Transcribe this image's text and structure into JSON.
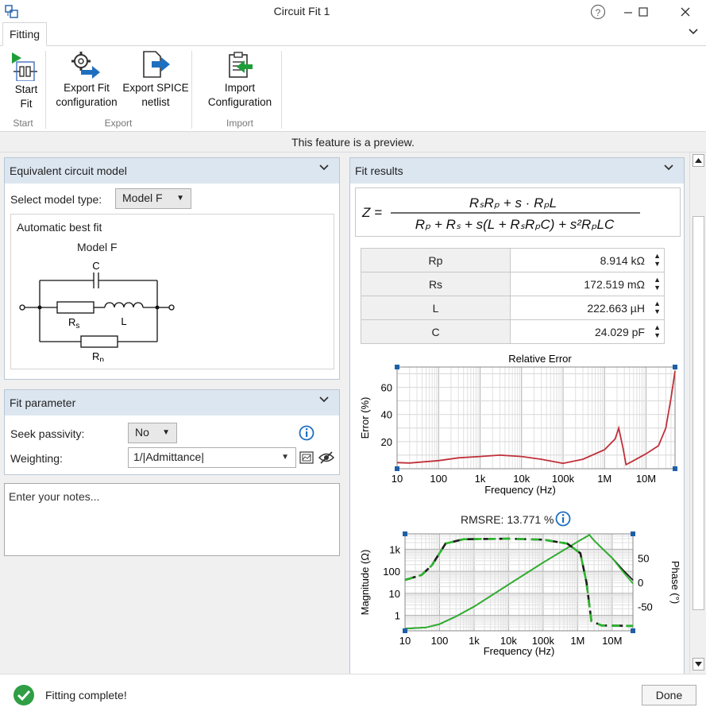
{
  "window": {
    "title": "Circuit Fit 1"
  },
  "tabs": {
    "fitting": "Fitting"
  },
  "ribbon": {
    "start_fit": [
      "Start",
      "Fit"
    ],
    "export_fit": [
      "Export Fit",
      "configuration"
    ],
    "export_spice": [
      "Export SPICE",
      "netlist"
    ],
    "import_cfg": [
      "Import",
      "Configuration"
    ],
    "groups": {
      "start": "Start",
      "export": "Export",
      "import": "Import"
    }
  },
  "preview_text": "This feature is a preview.",
  "equivalent": {
    "header": "Equivalent circuit model",
    "select_label": "Select model type:",
    "model_value": "Model F",
    "best_fit": "Automatic best fit",
    "model_title": "Model F",
    "labels": {
      "c": "C",
      "rs": "R",
      "rs_sub": "s",
      "l": "L",
      "rp": "R",
      "rp_sub": "p"
    }
  },
  "fit_param": {
    "header": "Fit parameter",
    "seek_label": "Seek passivity:",
    "seek_value": "No",
    "weighting_label": "Weighting:",
    "weighting_value": "1/|Admittance|"
  },
  "notes": {
    "placeholder": "Enter your notes..."
  },
  "fit_results": {
    "header": "Fit results",
    "params": [
      {
        "name": "Rp",
        "value": "8.914 kΩ"
      },
      {
        "name": "Rs",
        "value": "172.519 mΩ"
      },
      {
        "name": "L",
        "value": "222.663 µH"
      },
      {
        "name": "C",
        "value": "24.029 pF"
      }
    ],
    "rmsre_label": "RMSRE: 13.771 %"
  },
  "chart_data": [
    {
      "type": "line",
      "title": "Relative Error",
      "xlabel": "Frequency (Hz)",
      "ylabel": "Error (%)",
      "x_scale": "log",
      "xlim": [
        10,
        50000000
      ],
      "ylim": [
        0,
        75
      ],
      "x_ticks": [
        "10",
        "100",
        "1k",
        "10k",
        "100k",
        "1M",
        "10M"
      ],
      "y_ticks": [
        "20",
        "40",
        "60"
      ],
      "series": [
        {
          "color": "#c0303a",
          "points": [
            [
              10,
              4.5
            ],
            [
              20,
              4.2
            ],
            [
              100,
              6
            ],
            [
              300,
              8
            ],
            [
              1000,
              9
            ],
            [
              3000,
              10
            ],
            [
              10000,
              9
            ],
            [
              30000,
              7
            ],
            [
              100000,
              4
            ],
            [
              300000,
              7
            ],
            [
              1000000,
              14
            ],
            [
              1800000,
              22
            ],
            [
              2200000,
              30
            ],
            [
              2800000,
              15
            ],
            [
              3300000,
              3
            ],
            [
              5000000,
              6
            ],
            [
              10000000,
              11
            ],
            [
              20000000,
              17
            ],
            [
              30000000,
              30
            ],
            [
              40000000,
              52
            ],
            [
              50000000,
              72
            ]
          ]
        }
      ]
    },
    {
      "type": "line",
      "xlabel": "Frequency (Hz)",
      "ylabel": "Magnitude (Ω)",
      "y2label": "Phase (°)",
      "x_scale": "log",
      "y_scale": "log",
      "xlim": [
        10,
        40000000
      ],
      "ylim": [
        0.2,
        5000
      ],
      "y2lim": [
        -100,
        100
      ],
      "x_ticks": [
        "10",
        "100",
        "1k",
        "10k",
        "100k",
        "1M",
        "10M"
      ],
      "y_ticks": [
        "1",
        "10",
        "100",
        "1k"
      ],
      "y2_ticks": [
        "50",
        "0",
        "-50"
      ],
      "series": [
        {
          "color": "#1c1c1c",
          "axis": "left",
          "points": [
            [
              10,
              0.25
            ],
            [
              40,
              0.28
            ],
            [
              100,
              0.4
            ],
            [
              300,
              0.9
            ],
            [
              1000,
              2.5
            ],
            [
              10000,
              25
            ],
            [
              100000,
              250
            ],
            [
              1000000,
              2200
            ],
            [
              2200000,
              4500
            ],
            [
              3000000,
              2500
            ],
            [
              10000000,
              400
            ],
            [
              20000000,
              120
            ],
            [
              40000000,
              40
            ]
          ]
        },
        {
          "color": "#2db52d",
          "axis": "left",
          "points": [
            [
              10,
              0.25
            ],
            [
              40,
              0.28
            ],
            [
              100,
              0.4
            ],
            [
              300,
              0.9
            ],
            [
              1000,
              2.5
            ],
            [
              10000,
              25
            ],
            [
              100000,
              250
            ],
            [
              1000000,
              2200
            ],
            [
              2200000,
              4500
            ],
            [
              3000000,
              2500
            ],
            [
              10000000,
              400
            ],
            [
              20000000,
              100
            ],
            [
              40000000,
              28
            ]
          ]
        },
        {
          "color": "#1c1c1c",
          "axis": "right",
          "dashed": true,
          "points": [
            [
              10,
              5
            ],
            [
              30,
              15
            ],
            [
              60,
              35
            ],
            [
              150,
              80
            ],
            [
              500,
              89
            ],
            [
              10000,
              90
            ],
            [
              100000,
              88
            ],
            [
              500000,
              80
            ],
            [
              1200000,
              60
            ],
            [
              1800000,
              0
            ],
            [
              2500000,
              -80
            ],
            [
              5000000,
              -89
            ],
            [
              40000000,
              -90
            ]
          ]
        },
        {
          "color": "#2db52d",
          "axis": "right",
          "dashed": true,
          "points": [
            [
              10,
              5
            ],
            [
              30,
              15
            ],
            [
              60,
              35
            ],
            [
              150,
              80
            ],
            [
              500,
              89
            ],
            [
              10000,
              90
            ],
            [
              100000,
              88
            ],
            [
              500000,
              80
            ],
            [
              1200000,
              60
            ],
            [
              1800000,
              0
            ],
            [
              2500000,
              -80
            ],
            [
              5000000,
              -89
            ],
            [
              40000000,
              -90
            ]
          ]
        }
      ]
    }
  ],
  "status": {
    "text": "Fitting complete!",
    "done": "Done"
  },
  "colors": {
    "panel_header": "#dce6f0",
    "accent": "#1f6fc0",
    "success": "#2f9e44"
  }
}
